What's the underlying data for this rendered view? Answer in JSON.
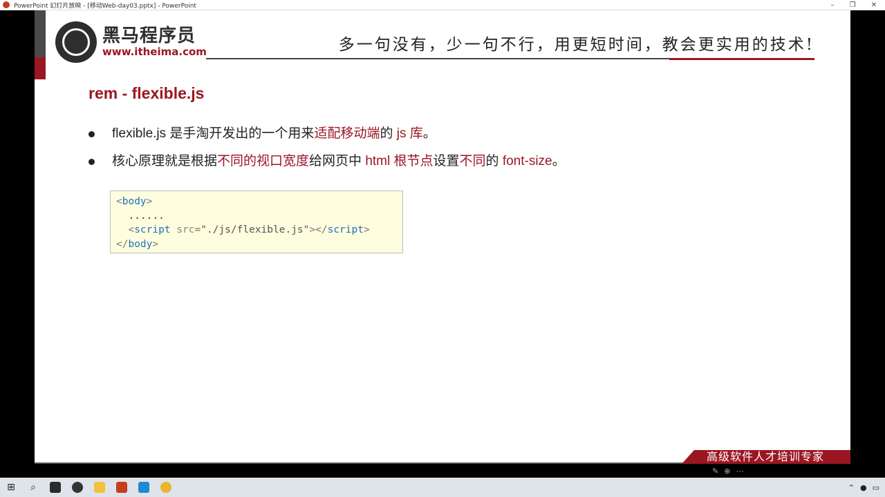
{
  "window": {
    "title": "PowerPoint 幻灯片放映 - [移动Web-day03.pptx] - PowerPoint",
    "controls": [
      "–",
      "❐",
      "✕"
    ]
  },
  "header": {
    "logo_cn": "黑马程序员",
    "logo_url": "www.itheima.com",
    "slogan": "多一句没有，少一句不行，用更短时间，教会更实用的技术!"
  },
  "slide": {
    "title": "rem - flexible.js",
    "bullet1": {
      "p1": "flexible.js 是手淘开发出的一个用来",
      "h1": "适配移动端",
      "p2": "的 ",
      "h2": "js 库",
      "p3": "。"
    },
    "bullet2": {
      "p1": "核心原理就是根据",
      "h1": "不同的视口宽度",
      "p2": "给网页中 ",
      "h2": "html 根节点",
      "p3": "设置",
      "h3": "不同",
      "p4": "的 ",
      "h4": "font-size",
      "p5": "。"
    },
    "code": {
      "l1_open": "<",
      "l1_tag": "body",
      "l1_close": ">",
      "l2": "  ......",
      "l3_indent": "  ",
      "l3_open": "<",
      "l3_tag": "script",
      "l3_attr": " src",
      "l3_eq": "=",
      "l3_val": "\"./js/flexible.js\"",
      "l3_mid": "></",
      "l3_tag2": "script",
      "l3_end": ">",
      "l4_open": "</",
      "l4_tag": "body",
      "l4_close": ">"
    },
    "footer": "高级软件人才培训专家"
  },
  "colors": {
    "accent": "#9a1722",
    "code_bg": "#fefede",
    "tag": "#1f6fbf"
  }
}
